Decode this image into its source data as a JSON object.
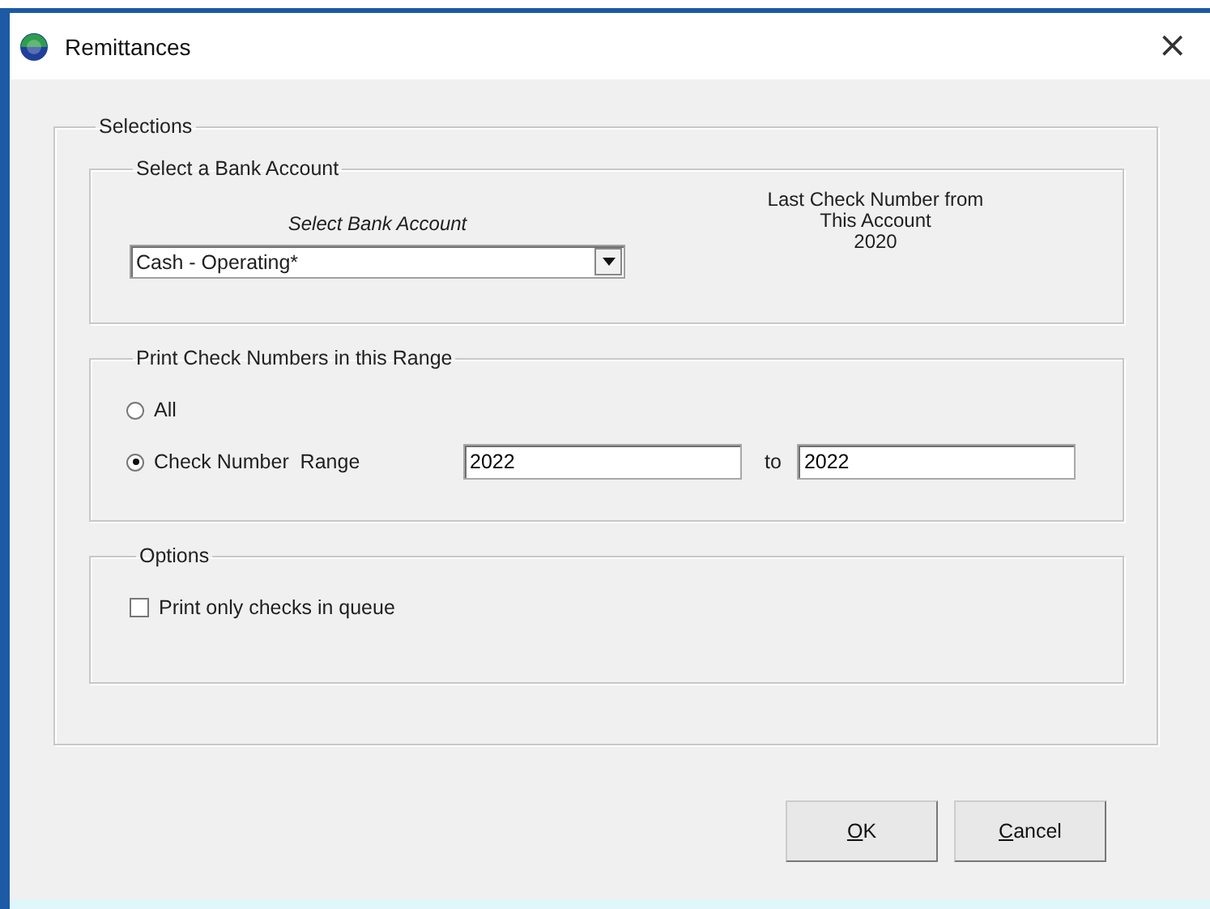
{
  "window": {
    "title": "Remittances",
    "close": "×"
  },
  "selections": {
    "legend": "Selections",
    "bank_account": {
      "legend": "Select a Bank Account",
      "combo_label": "Select Bank Account",
      "combo_value": "Cash - Operating*",
      "last_check_label": "Last Check Number from\nThis Account",
      "last_check_number": "2020"
    },
    "range": {
      "legend": "Print Check Numbers in this Range",
      "options": [
        {
          "label": "All",
          "selected": false
        },
        {
          "label": "Check Number  Range",
          "selected": true
        }
      ],
      "from": "2022",
      "to_label": "to",
      "to": "2022"
    },
    "options": {
      "legend": "Options",
      "items": [
        {
          "label": "Print only checks in queue",
          "checked": false
        }
      ]
    }
  },
  "buttons": [
    {
      "label": "OK"
    },
    {
      "label": "Cancel"
    }
  ]
}
